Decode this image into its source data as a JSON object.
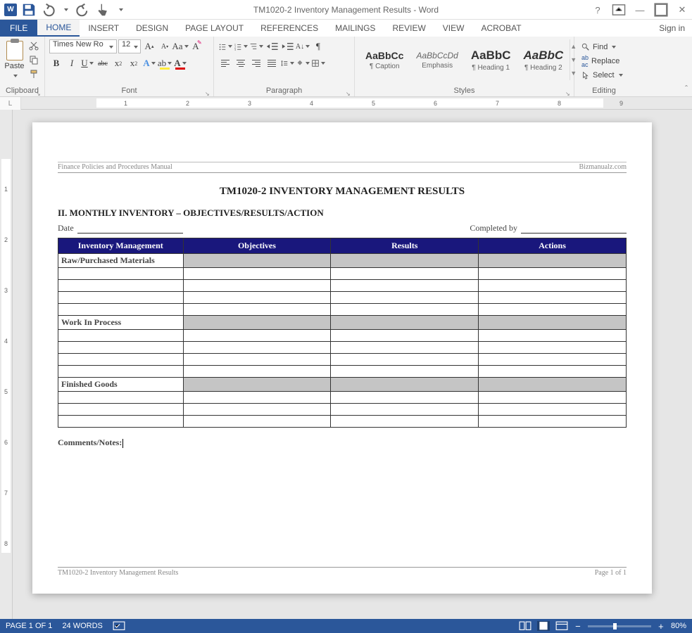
{
  "titlebar": {
    "title": "TM1020-2 Inventory Management Results - Word"
  },
  "tabs": {
    "file": "FILE",
    "items": [
      "HOME",
      "INSERT",
      "DESIGN",
      "PAGE LAYOUT",
      "REFERENCES",
      "MAILINGS",
      "REVIEW",
      "VIEW",
      "ACROBAT"
    ],
    "active": 0,
    "signin": "Sign in"
  },
  "ribbon": {
    "clipboard": {
      "paste": "Paste",
      "label": "Clipboard"
    },
    "font": {
      "name": "Times New Ro",
      "size": "12",
      "label": "Font"
    },
    "paragraph": {
      "label": "Paragraph"
    },
    "styles": {
      "label": "Styles",
      "items": [
        {
          "preview": "AaBbCc",
          "name": "¶ Caption",
          "weight": "bold",
          "color": "#333"
        },
        {
          "preview": "AaBbCcDd",
          "name": "Emphasis",
          "style": "italic",
          "color": "#555"
        },
        {
          "preview": "AaBbC",
          "name": "¶ Heading 1",
          "weight": "bold",
          "color": "#333",
          "size": "17px"
        },
        {
          "preview": "AaBbC",
          "name": "¶ Heading 2",
          "style": "italic",
          "weight": "bold",
          "color": "#333",
          "size": "17px"
        }
      ]
    },
    "editing": {
      "find": "Find",
      "replace": "Replace",
      "select": "Select",
      "label": "Editing"
    }
  },
  "ruler_corner": "L",
  "document": {
    "header_left": "Finance Policies and Procedures Manual",
    "header_right": "Bizmanualz.com",
    "title": "TM1020-2 INVENTORY MANAGEMENT RESULTS",
    "subtitle": "II. MONTHLY INVENTORY – OBJECTIVES/RESULTS/ACTION",
    "date_label": "Date",
    "completed_label": "Completed by",
    "table": {
      "headers": [
        "Inventory Management",
        "Objectives",
        "Results",
        "Actions"
      ],
      "sections": [
        {
          "label": "Raw/Purchased Materials",
          "rows": 4
        },
        {
          "label": "Work In Process",
          "rows": 4
        },
        {
          "label": "Finished Goods",
          "rows": 3
        }
      ]
    },
    "comments": "Comments/Notes:",
    "footer_left": "TM1020-2 Inventory Management Results",
    "footer_right": "Page 1 of 1"
  },
  "statusbar": {
    "page": "PAGE 1 OF 1",
    "words": "24 WORDS",
    "zoom": "80%"
  }
}
